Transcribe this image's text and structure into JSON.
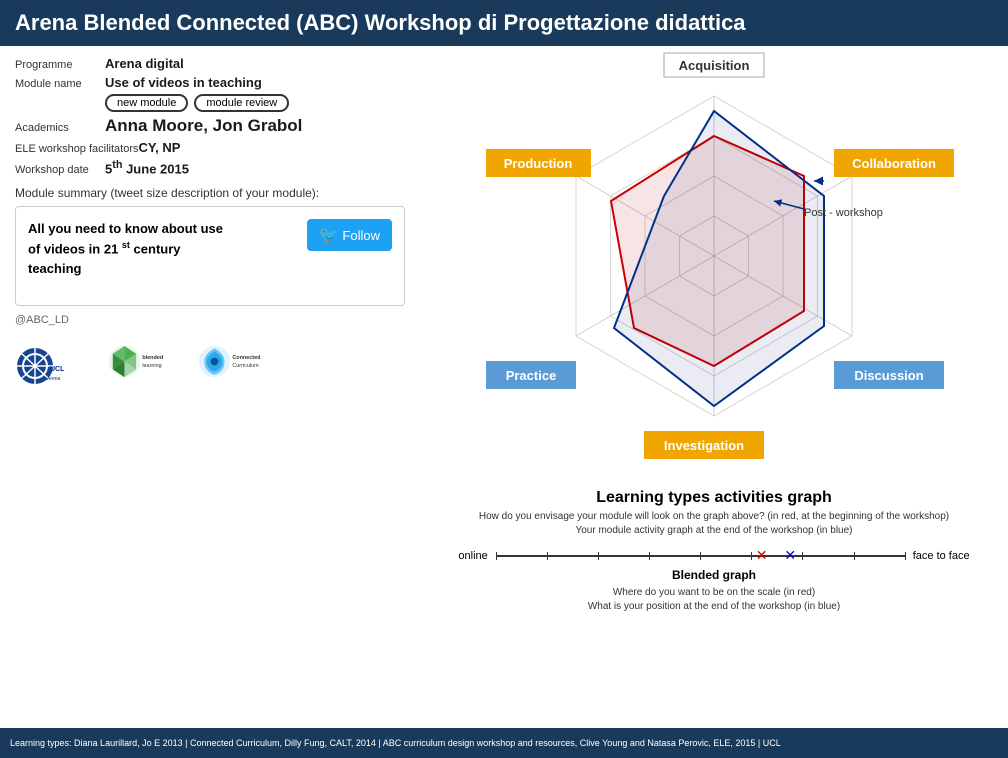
{
  "header": {
    "title": "Arena Blended Connected (ABC) Workshop di Progettazione didattica"
  },
  "left": {
    "programme_label": "Programme",
    "programme_value": "Arena digital",
    "module_name_label": "Module name",
    "module_name_value": "Use of videos in teaching",
    "module_type_label": "new module",
    "module_type_options": [
      "new module",
      "module review"
    ],
    "academics_label": "Academics",
    "academics_value": "Anna Moore, Jon Grabol",
    "facilitators_label": "ELE workshop facilitators",
    "facilitators_value": "CY, NP",
    "workshop_date_label": "Workshop date",
    "workshop_date_value": "5th June 2015",
    "summary_label": "Module summary (tweet size description of your module):",
    "tweet_text_line1": "All you need to know about use",
    "tweet_text_line2": "of videos in 21",
    "tweet_text_sup": "st",
    "tweet_text_line3": " century",
    "tweet_text_line4": "teaching",
    "follow_button": "Follow",
    "abc_handle": "@ABC_LD"
  },
  "radar": {
    "acquisition": "Acquisition",
    "production": "Production",
    "collaboration": "Collaboration",
    "practice": "Practice",
    "discussion": "Discussion",
    "investigation": "Investigation",
    "post_workshop": "Post - workshop"
  },
  "learning_types": {
    "title": "Learning types activities graph",
    "description": "How do you envisage your module will look on the graph above? (in red, at the beginning of the workshop)\nYour module activity graph at the end of the workshop (in blue)",
    "scale_left": "online",
    "scale_right": "face to face",
    "blended_title": "Blended graph",
    "blended_question1": "Where do you want to be on the scale (in red)",
    "blended_question2": "What is your position at the end of the workshop (in blue)"
  },
  "footer": {
    "text": "Learning types: Diana Laurillard, Jo E 2013 | Connected Curriculum, Dilly Fung, CALT, 2014 | ABC curriculum design workshop and resources, Clive Young and Natasa Perovic, ELE, 2015 | UCL"
  }
}
